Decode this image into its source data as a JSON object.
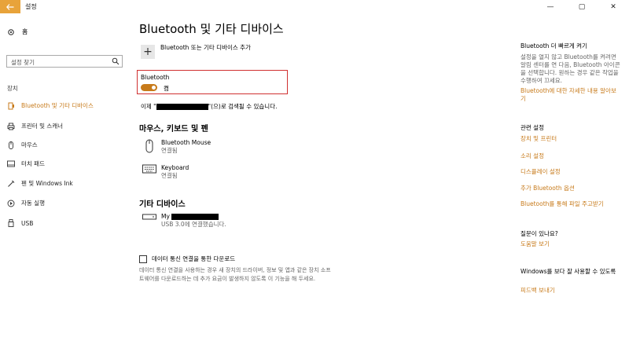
{
  "window": {
    "title": "설정",
    "controls": [
      "—",
      "▢",
      "✕"
    ]
  },
  "sidebar": {
    "home_label": "홈",
    "search_placeholder": "설정 찾기",
    "section_label": "장치",
    "items": [
      {
        "label": "Bluetooth 및 기타 디바이스",
        "icon": "bluetooth-devices-icon",
        "active": true
      },
      {
        "label": "프린터 및 스캐너",
        "icon": "printer-icon",
        "active": false
      },
      {
        "label": "마우스",
        "icon": "mouse-icon",
        "active": false
      },
      {
        "label": "터치 패드",
        "icon": "touchpad-icon",
        "active": false
      },
      {
        "label": "펜 및 Windows Ink",
        "icon": "pen-icon",
        "active": false
      },
      {
        "label": "자동 실행",
        "icon": "autoplay-icon",
        "active": false
      },
      {
        "label": "USB",
        "icon": "usb-icon",
        "active": false
      }
    ]
  },
  "main": {
    "title": "Bluetooth 및 기타 디바이스",
    "add_device_label": "Bluetooth 또는 기타 디바이스 추가",
    "bluetooth_label": "Bluetooth",
    "bluetooth_state": "켬",
    "discoverable_prefix": "이제 \"",
    "discoverable_suffix": "\"(으)로 검색될 수 있습니다.",
    "mkp_heading": "마우스, 키보드 및 펜",
    "mkp_devices": [
      {
        "name": "Bluetooth Mouse",
        "status": "연결됨",
        "icon": "mouse-icon"
      },
      {
        "name": "Keyboard",
        "status": "연결됨",
        "icon": "keyboard-icon"
      }
    ],
    "other_heading": "기타 디바이스",
    "other_device": {
      "name_prefix": "My",
      "status": "USB 3.0에 연결했습니다.",
      "icon": "drive-icon"
    },
    "metered_label": "데이터 통신 연결을 통한 다운로드",
    "metered_desc": "데이터 통신 연결을 사용하는 경우 새 장치의 드라이버, 정보 및 앱과 같은 장치 소프트웨어를 다운로드하는 데 추가 요금이 발생하지 않도록 이 기능을 해 두세요."
  },
  "right_panel": {
    "quick_heading": "Bluetooth 더 빠르게 켜기",
    "quick_text": "설정을 열지 않고 Bluetooth를 켜려면 알림 센터를 연 다음, Bluetooth 아이콘을 선택합니다. 원하는 경우 같은 작업을 수행하여 끄세요.",
    "quick_link": "Bluetooth에 대한 자세한 내용 알아보기",
    "related_heading": "관련 설정",
    "related_links": [
      "장치 및 프린터",
      "소리 설정",
      "디스플레이 설정",
      "추가 Bluetooth 옵션",
      "Bluetooth를 통해 파일 주고받기"
    ],
    "question_heading": "질문이 있나요?",
    "help_link": "도움말 보기",
    "better_heading": "Windows를 보다 잘 사용할 수 있도록",
    "feedback_link": "피드백 보내기"
  },
  "colors": {
    "accent": "#c77a1a",
    "back_button": "#e8a33a",
    "highlight_border": "#d03030"
  }
}
